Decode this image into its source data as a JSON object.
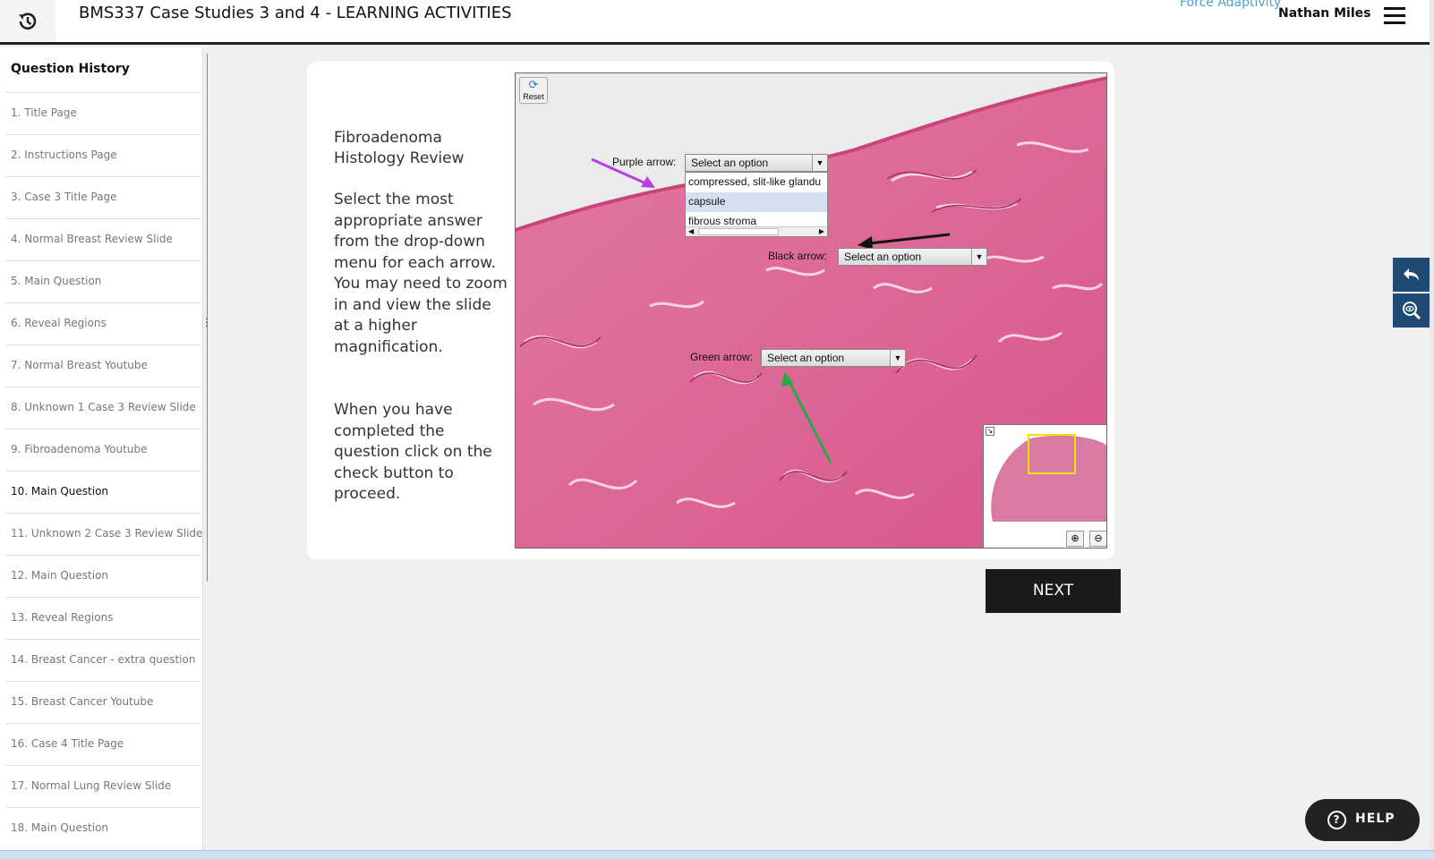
{
  "header": {
    "title": "BMS337 Case Studies 3 and 4 - LEARNING ACTIVITIES",
    "force_link": "Force Adaptivity",
    "user_name": "Nathan Miles"
  },
  "sidebar": {
    "title": "Question History",
    "items": [
      {
        "label": "1. Title Page"
      },
      {
        "label": "2. Instructions Page"
      },
      {
        "label": "3. Case 3 Title Page"
      },
      {
        "label": "4. Normal Breast Review Slide"
      },
      {
        "label": "5. Main Question"
      },
      {
        "label": "6. Reveal Regions"
      },
      {
        "label": "7. Normal Breast Youtube"
      },
      {
        "label": "8. Unknown 1 Case 3 Review Slide"
      },
      {
        "label": "9. Fibroadenoma Youtube"
      },
      {
        "label": "10. Main Question"
      },
      {
        "label": "11. Unknown 2 Case 3 Review Slide"
      },
      {
        "label": "12. Main Question"
      },
      {
        "label": "13. Reveal Regions"
      },
      {
        "label": "14. Breast Cancer - extra question"
      },
      {
        "label": "15. Breast Cancer Youtube"
      },
      {
        "label": "16. Case 4 Title Page"
      },
      {
        "label": "17. Normal Lung Review Slide"
      },
      {
        "label": "18. Main Question"
      }
    ],
    "active_index": 9
  },
  "card": {
    "heading": "Fibroadenoma Histology Review",
    "instructions": "Select the most appropriate answer from the drop-down menu for each arrow. You may need to zoom in and view the slide at a higher magnification.",
    "completion": "When you have completed the question click on the check button to proceed."
  },
  "viewer": {
    "reset_label": "Reset",
    "purple_label": "Purple arrow:",
    "purple_value": "Select an option",
    "black_label": "Black arrow:",
    "black_value": "Select an option",
    "green_label": "Green arrow:",
    "green_value": "Select an option",
    "dropdown_options": [
      "compressed, slit-like glandu",
      "capsule",
      "fibrous stroma"
    ],
    "highlighted_option": 1,
    "arrow_colors": {
      "purple": "#b540e0",
      "black": "#111111",
      "green": "#2aa84a"
    }
  },
  "next_label": "NEXT",
  "help_label": "HELP",
  "colors": {
    "accent": "#1f4a73",
    "link": "#4aa3df",
    "tissue": "#d95a8a"
  }
}
